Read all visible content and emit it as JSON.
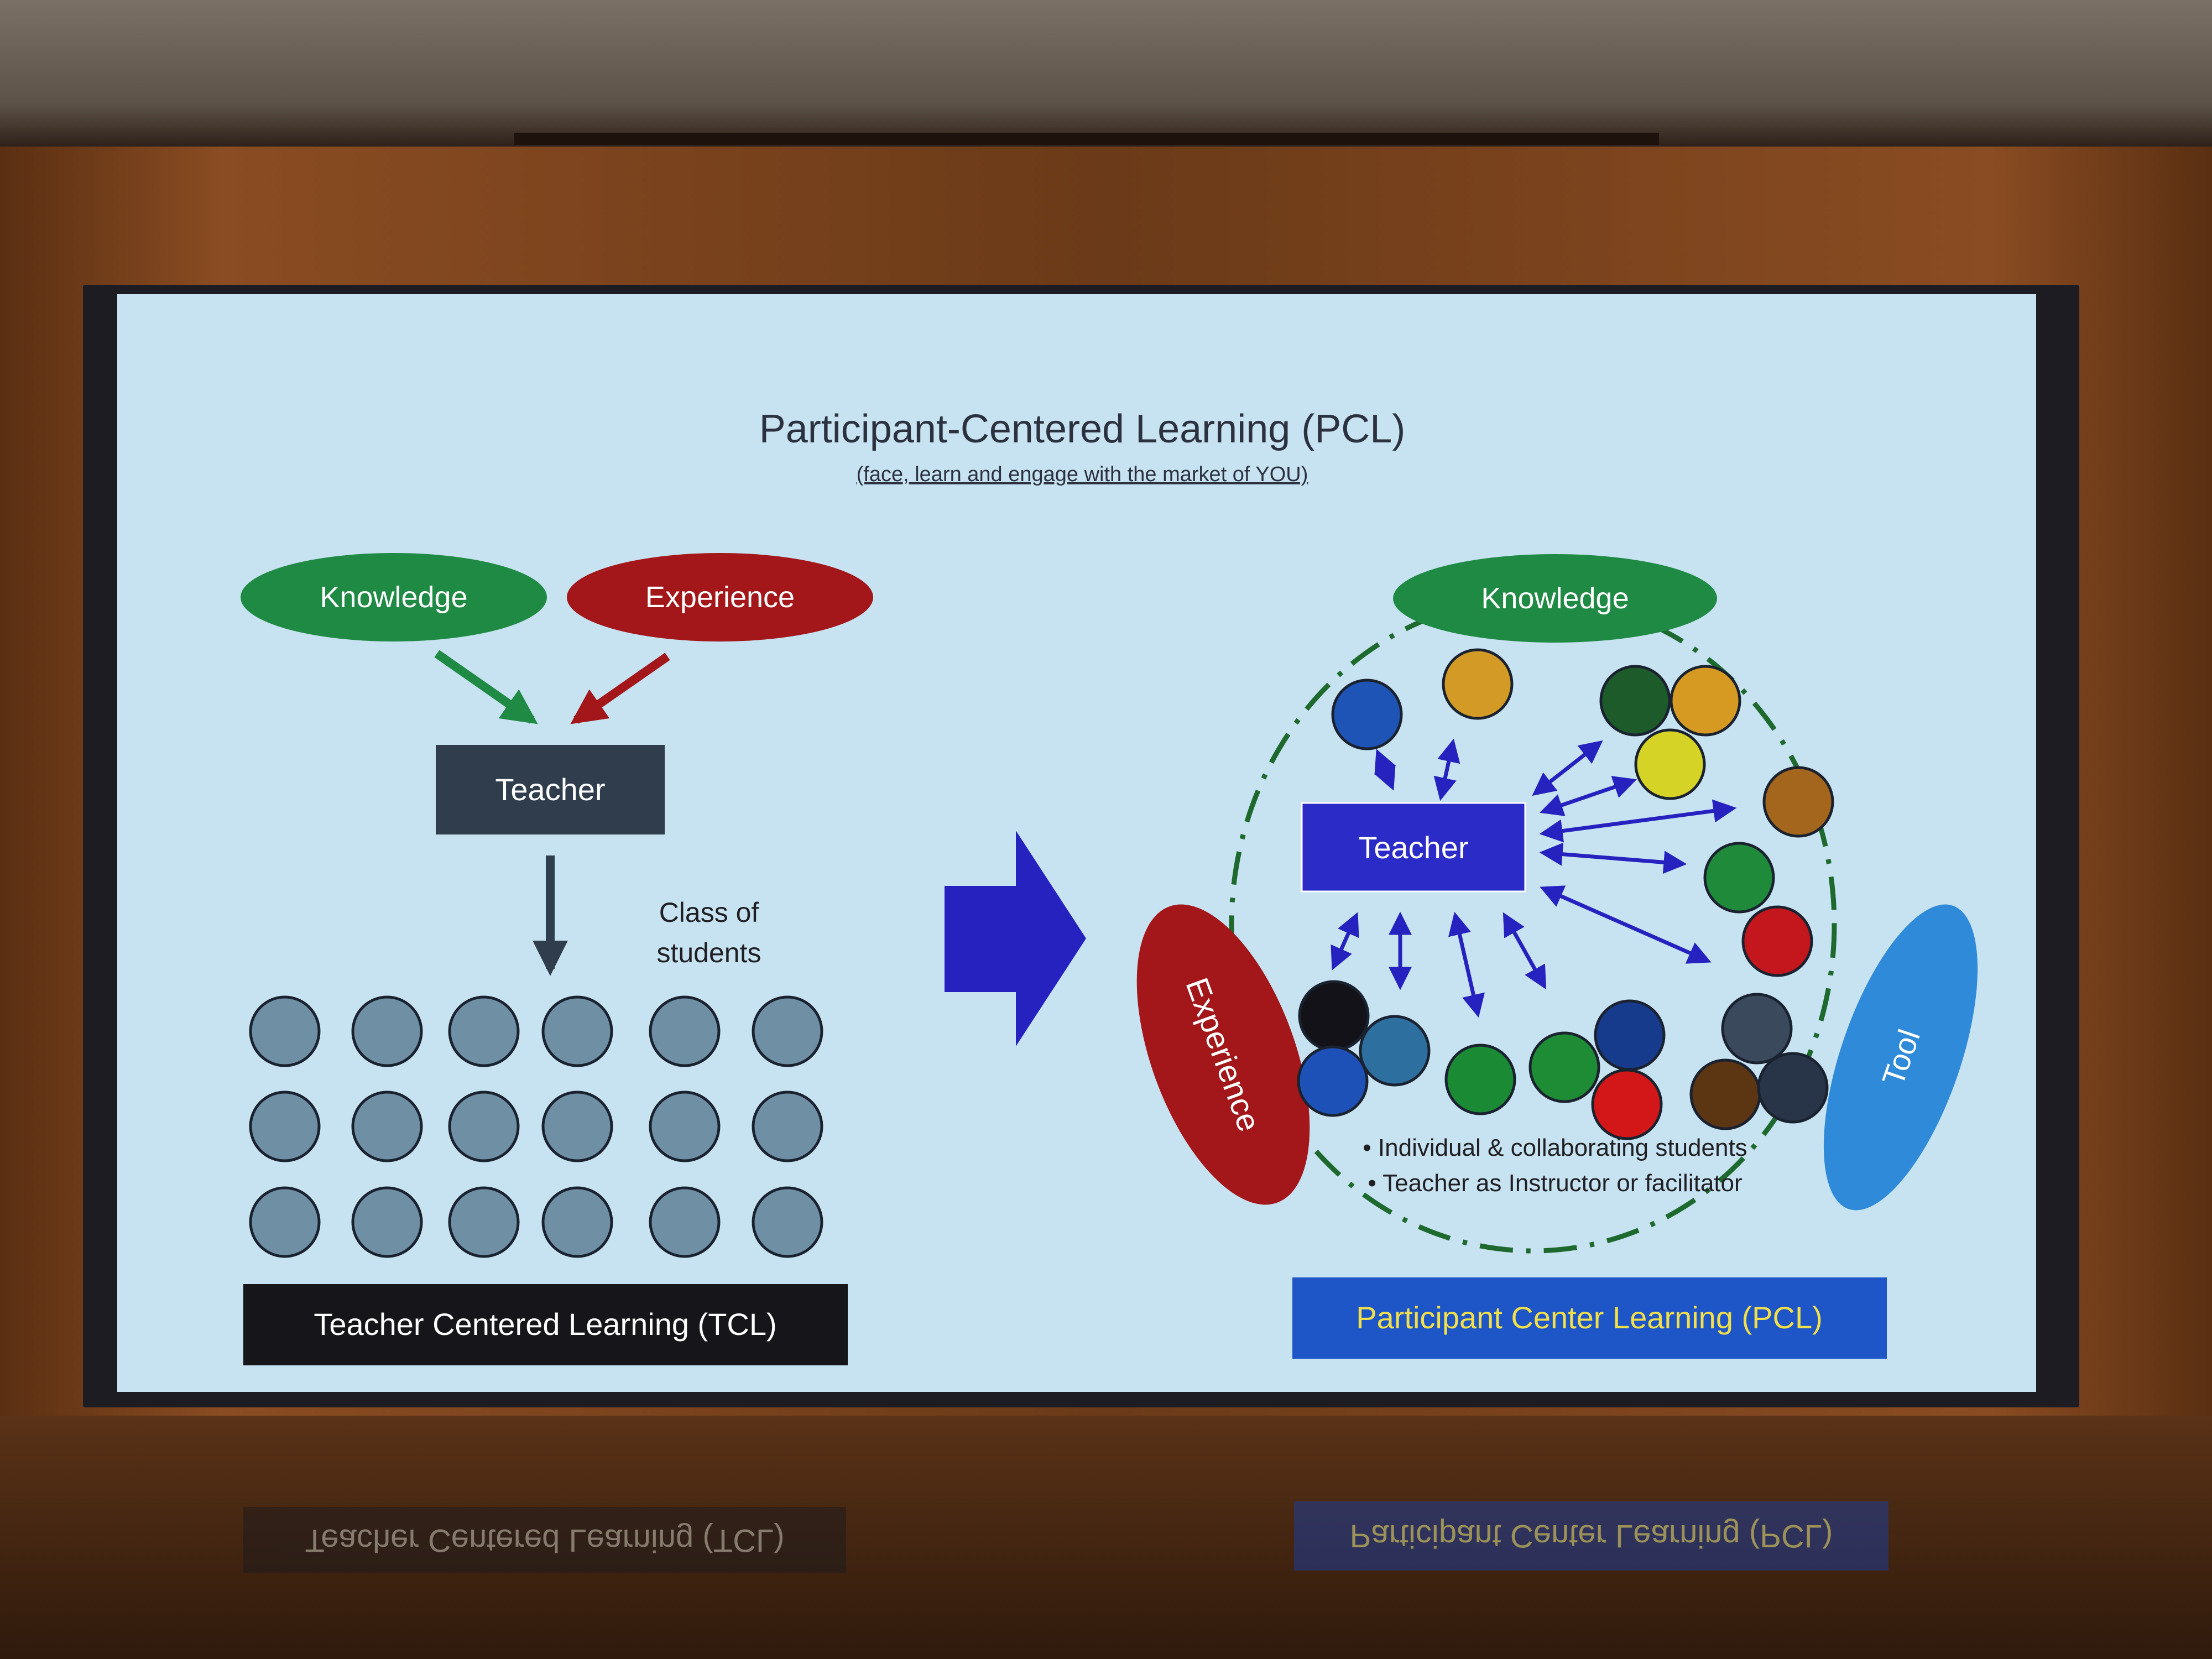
{
  "slide": {
    "title": "Participant-Centered Learning (PCL)",
    "subtitle": "(face, learn and engage with the market of YOU)"
  },
  "tcl": {
    "knowledge_label": "Knowledge",
    "experience_label": "Experience",
    "teacher_label": "Teacher",
    "class_label_line1": "Class of",
    "class_label_line2": "students",
    "footer_label": "Teacher Centered Learning (TCL)"
  },
  "pcl": {
    "knowledge_label": "Knowledge",
    "experience_label": "Experience",
    "tool_label": "Tool",
    "teacher_label": "Teacher",
    "bullet1": "• Individual & collaborating students",
    "bullet2": "• Teacher as Instructor or facilitator",
    "footer_label": "Participant Center Learning (PCL)"
  },
  "colors": {
    "screen_bg": "#c7e2f1",
    "knowledge_green": "#1f8a43",
    "experience_red": "#a3171b",
    "teacher_tcl_box": "#2f3d4c",
    "teacher_pcl_box": "#2b2bc8",
    "arrow_blue": "#2522c0",
    "student_grey": "#6f8fa5",
    "tool_blue": "#2f8ad9",
    "pcl_footer_bg": "#1f56c7",
    "pcl_footer_text": "#f2e04a",
    "tcl_footer_bg": "#15151a"
  },
  "students_pcl_colors": [
    "#1d54b6",
    "#d39b26",
    "#1d5b2a",
    "#d69a23",
    "#d4d326",
    "#a4661c",
    "#1f8b3a",
    "#c4161d",
    "#121218",
    "#2d6f9f",
    "#1e51b8",
    "#1a8a35",
    "#1e8b35",
    "#163b8c",
    "#d31718",
    "#3a4a5c",
    "#5c3512",
    "#283447"
  ]
}
